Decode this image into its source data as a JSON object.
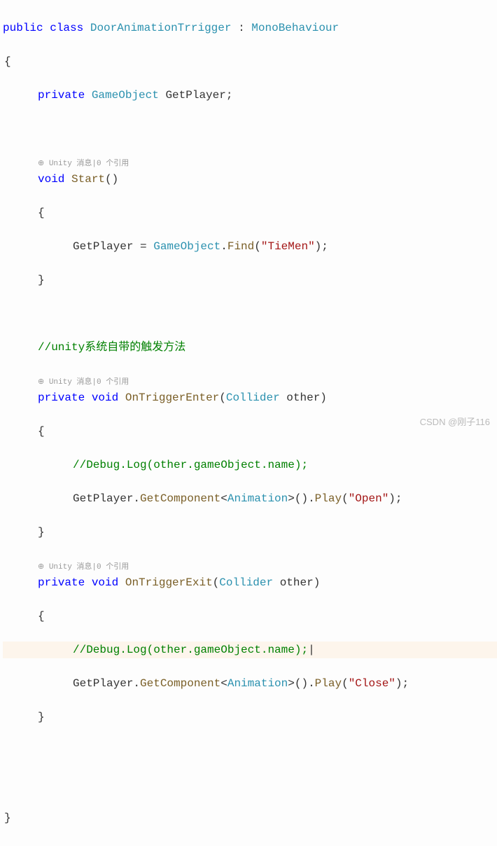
{
  "code": {
    "l1_public": "public",
    "l1_class": "class",
    "l1_classname": "DoorAnimationTrrigger",
    "l1_colon": " : ",
    "l1_base": "MonoBehaviour",
    "l2": "{",
    "l3_private": "private",
    "l3_type": "GameObject",
    "l3_name": " GetPlayer;",
    "lens1": "⊕ Unity 消息|0 个引用",
    "l5_void": "void",
    "l5_method": "Start",
    "l5_paren": "()",
    "l6": "{",
    "l7_name": "GetPlayer = ",
    "l7_type": "GameObject",
    "l7_dot": ".",
    "l7_find": "Find",
    "l7_p1": "(",
    "l7_str": "\"TieMen\"",
    "l7_p2": ");",
    "l8": "}",
    "l10_comment": "//unity系统自带的触发方法",
    "lens2": "⊕ Unity 消息|0 个引用",
    "l11_private": "private",
    "l11_void": "void",
    "l11_method": "OnTriggerEnter",
    "l11_p1": "(",
    "l11_type": "Collider",
    "l11_arg": " other)",
    "l12": "{",
    "l13_comment": "//Debug.Log(other.gameObject.name);",
    "l14_a": "GetPlayer.",
    "l14_get": "GetComponent",
    "l14_lt": "<",
    "l14_anim": "Animation",
    "l14_gt": ">().",
    "l14_play": "Play",
    "l14_p1": "(",
    "l14_str": "\"Open\"",
    "l14_p2": ");",
    "l15": "}",
    "lens3": "⊕ Unity 消息|0 个引用",
    "l16_private": "private",
    "l16_void": "void",
    "l16_method": "OnTriggerExit",
    "l16_p1": "(",
    "l16_type": "Collider",
    "l16_arg": " other)",
    "l17": "{",
    "l18_comment": "//Debug.Log(other.gameObject.name);",
    "l18_cursor": "|",
    "l19_a": "GetPlayer.",
    "l19_get": "GetComponent",
    "l19_lt": "<",
    "l19_anim": "Animation",
    "l19_gt": ">().",
    "l19_play": "Play",
    "l19_p1": "(",
    "l19_str": "\"Close\"",
    "l19_p2": ");",
    "l20": "}",
    "l23": "}"
  },
  "watermark": "CSDN @刚子116"
}
